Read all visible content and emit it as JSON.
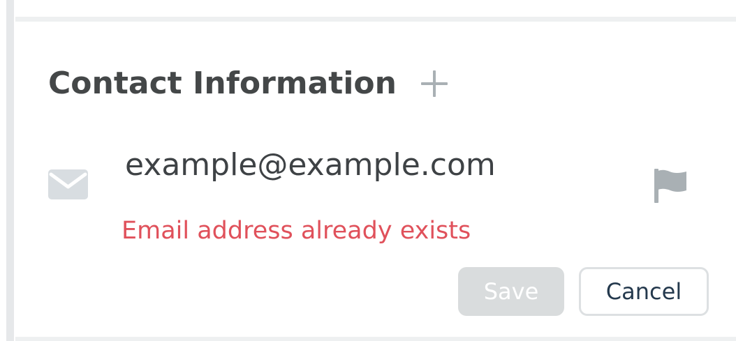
{
  "section": {
    "title": "Contact Information",
    "add_icon": "plus-icon"
  },
  "contact": {
    "type_icon": "envelope-icon",
    "email": "example@example.com",
    "flag_icon": "flag-icon",
    "error": "Email address already exists"
  },
  "actions": {
    "save_label": "Save",
    "cancel_label": "Cancel"
  },
  "colors": {
    "error": "#e0515b",
    "title": "#444748",
    "icon_gray": "#a9b0b4",
    "disabled_button": "#d9dcdd",
    "cancel_text": "#24394d"
  }
}
